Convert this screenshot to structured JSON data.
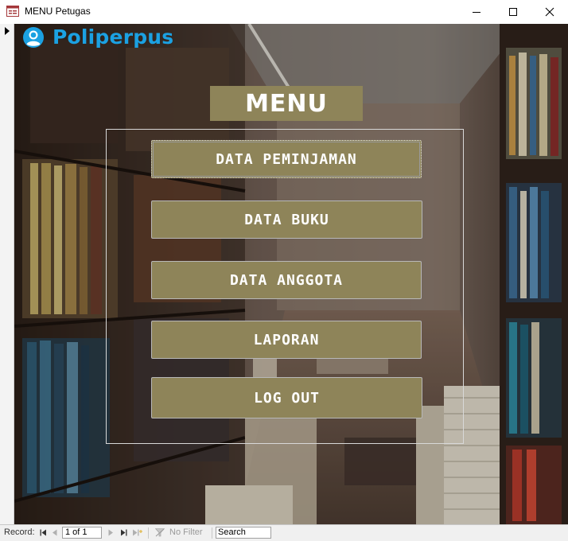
{
  "window": {
    "title": "MENU Petugas"
  },
  "logo": {
    "text": "Poliperpus"
  },
  "menu": {
    "title": "MENU",
    "buttons": [
      {
        "label": "DATA PEMINJAMAN"
      },
      {
        "label": "DATA BUKU"
      },
      {
        "label": "DATA ANGGOTA"
      },
      {
        "label": "LAPORAN"
      },
      {
        "label": "LOG OUT"
      }
    ]
  },
  "navbar": {
    "record_label": "Record:",
    "record_value": "1 of 1",
    "filter_label": "No Filter",
    "search_value": "Search"
  },
  "colors": {
    "button_fill": "#8e8459",
    "logo_blue": "#1ba1e2"
  }
}
